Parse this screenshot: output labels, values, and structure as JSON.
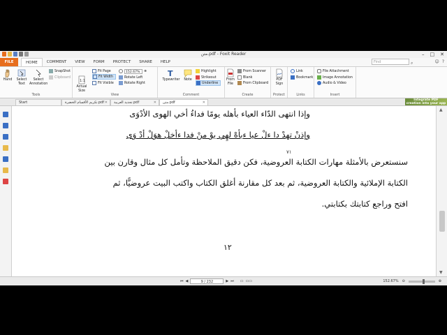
{
  "window": {
    "title": "متن.pdf - Foxit Reader"
  },
  "menubar": {
    "file_label": "FILE",
    "tabs": [
      "HOME",
      "COMMENT",
      "VIEW",
      "FORM",
      "PROTECT",
      "SHARE",
      "HELP"
    ],
    "active_tab": "HOME",
    "find_placeholder": "Find"
  },
  "ribbon": {
    "tools": {
      "hand": "Hand",
      "select_text": [
        "Select",
        "Text"
      ],
      "select_annotation": [
        "Select",
        "Annotation"
      ],
      "snapshot": "SnapShot",
      "clipboard": "Clipboard",
      "group": "Tools"
    },
    "view": {
      "actual_size": [
        "Actual",
        "Size"
      ],
      "fit_page": "Fit Page",
      "fit_width": "Fit Width",
      "fit_visible": "Fit Visible",
      "zoom": "152.67%",
      "rotate_left": "Rotate Left",
      "rotate_right": "Rotate Right",
      "group": "View"
    },
    "comment": {
      "typewriter": "Typewriter",
      "note": "Note",
      "highlight": "Highlight",
      "strikeout": "Strikeout",
      "underline": "Underline",
      "group": "Comment"
    },
    "create": {
      "from_file": [
        "From",
        "File"
      ],
      "from_scanner": "From Scanner",
      "blank": "Blank",
      "from_clipboard": "From Clipboard",
      "group": "Create"
    },
    "protect": {
      "pdf_sign": [
        "PDF",
        "Sign"
      ],
      "group": "Protect"
    },
    "links": {
      "link": "Link",
      "bookmark": "Bookmark",
      "group": "Links"
    },
    "insert": {
      "file_attachment": "File Attachment",
      "image_annotation": "Image Annotation",
      "audio_video": "Audio & Video",
      "group": "Insert"
    }
  },
  "doc_tabs": [
    {
      "label": "Start"
    },
    {
      "label": "تكريم الأقسام الخضرة.pdf"
    },
    {
      "label": "تجديد العربية.pdf"
    },
    {
      "label": "متن.pdf"
    }
  ],
  "promo": [
    "Integrate PDF",
    "creation into your app"
  ],
  "document": {
    "line1": "وإذا انتهى الدّاء العياء بأهله يومًا  فداءُ أخي الهوى الأدْوَى",
    "line2": "وإذنْ تهدْ دا ءلْ عيا ءبأهْ لهِي يوْ منْ فدا ءأخلْ هوَلْ أدْ وَى",
    "footnote": "٧١",
    "para1": "سنستعرض بالأمثلة مهارات الكتابة العروضية، فكن دقيق الملاحظة وتأمل كل مثال وقارن بين",
    "para2": "الكتابة الإملائية والكتابة العروضية، ثم بعد كل مقارنة أغلق الكتاب واكتب البيت عروضيًّا، ثم",
    "para3": "افتح وراجع كتابتك بكتابتي.",
    "page_number": "١٢"
  },
  "status": {
    "page_box": "9 / 232",
    "zoom": "152.67%"
  },
  "colors": {
    "accent": "#e76e1e",
    "ribbon_bg": "#fbfbfb",
    "selected": "#cfe3f7"
  }
}
